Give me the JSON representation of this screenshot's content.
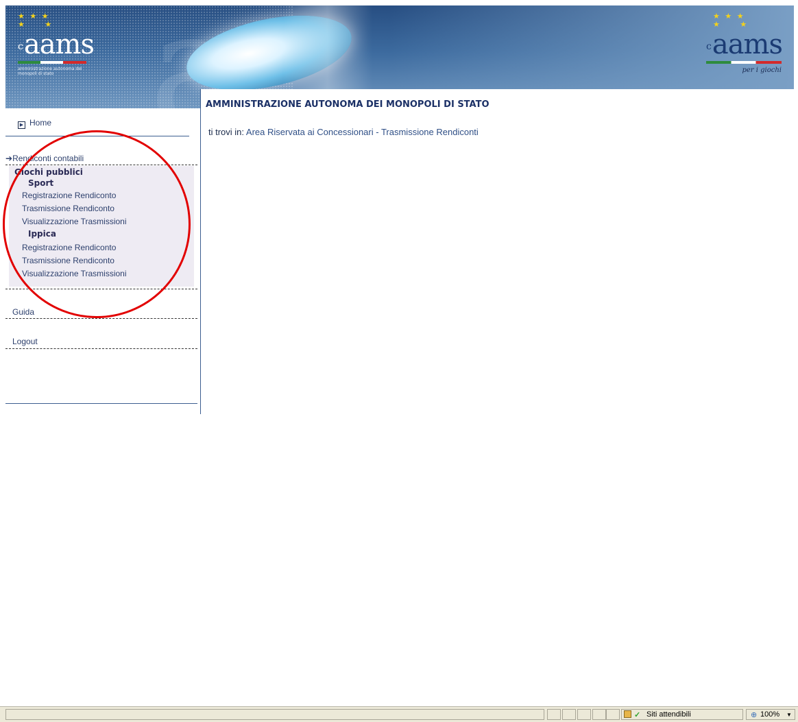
{
  "header": {
    "logo_left_text": "aams",
    "logo_left_subtitle": "amministrazione autonoma dei monopoli di stato",
    "logo_right_text": "aams",
    "logo_right_tagline": "per i giochi"
  },
  "sidebar": {
    "home_label": "Home",
    "section_label": "Rendiconti contabili",
    "group_label": "Giochi pubblici",
    "subgroups": [
      {
        "label": "Sport",
        "items": [
          "Registrazione Rendiconto",
          "Trasmissione Rendiconto",
          "Visualizzazione Trasmissioni"
        ]
      },
      {
        "label": "Ippica",
        "items": [
          "Registrazione Rendiconto",
          "Trasmissione Rendiconto",
          "Visualizzazione Trasmissioni"
        ]
      }
    ],
    "guida_label": "Guida",
    "logout_label": "Logout"
  },
  "main": {
    "title": "AMMINISTRAZIONE AUTONOMA DEI MONOPOLI DI STATO",
    "breadcrumb_prefix": "ti trovi in: ",
    "breadcrumb_part1": "Area Riservata ai Concessionari",
    "breadcrumb_sep": " - ",
    "breadcrumb_part2": "Trasmissione Rendiconti"
  },
  "statusbar": {
    "zone_label": "Siti attendibili",
    "zoom_label": "100%"
  },
  "colors": {
    "annotation_circle": "#e20000",
    "banner_blue": "#3c6a9e",
    "title_blue": "#1b3066"
  }
}
